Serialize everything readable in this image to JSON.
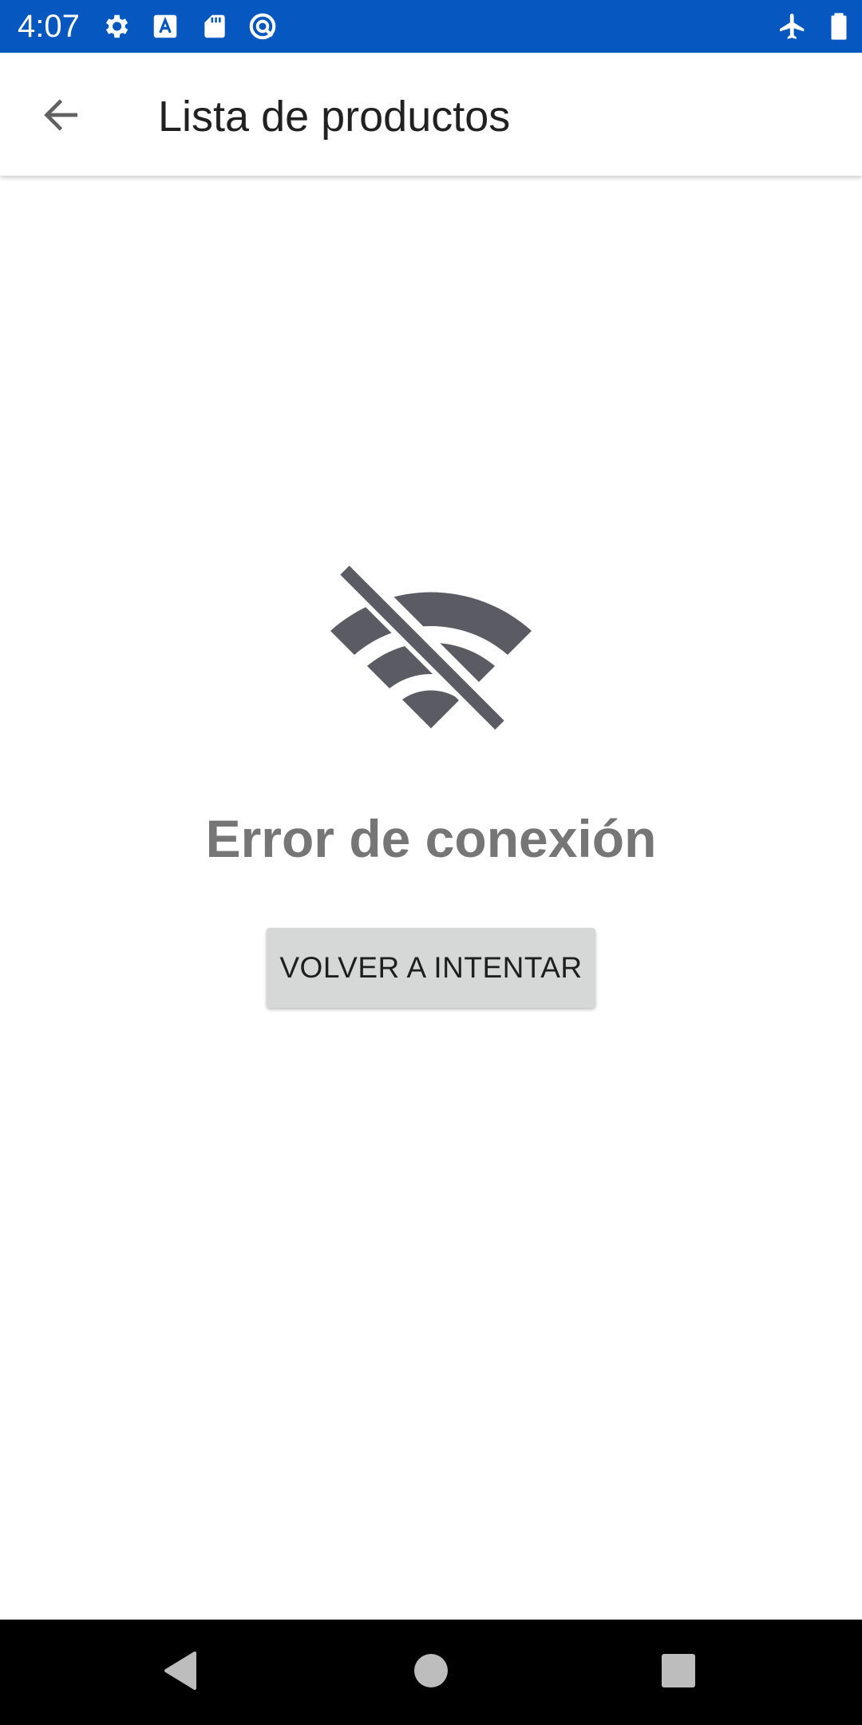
{
  "status_bar": {
    "time": "4:07",
    "background_color": "#0657C0",
    "left_icons": [
      "settings-icon",
      "text-a-icon",
      "sd-card-icon",
      "vpn-key-icon"
    ],
    "right_icons": [
      "airplane-mode-icon",
      "battery-icon"
    ]
  },
  "app_bar": {
    "back_icon": "arrow-back-icon",
    "title": "Lista de productos"
  },
  "main": {
    "icon": "wifi-off-icon",
    "icon_color": "#5B5B63",
    "error_message": "Error de conexión",
    "retry_button_label": "VOLVER A INTENTAR"
  },
  "nav_bar": {
    "buttons": [
      "back-triangle-icon",
      "home-circle-icon",
      "recents-square-icon"
    ]
  }
}
